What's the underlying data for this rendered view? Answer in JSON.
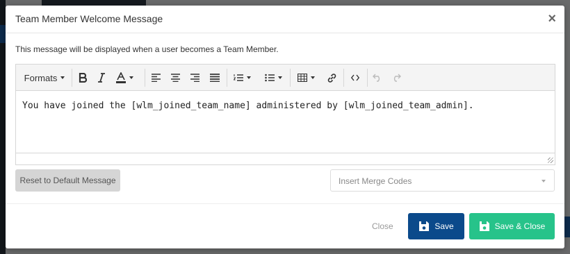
{
  "modal": {
    "title": "Team Member Welcome Message",
    "close_glyph": "×",
    "description": "This message will be displayed when a user becomes a Team Member."
  },
  "editor": {
    "toolbar": {
      "formats_label": "Formats",
      "buttons": [
        "bold-icon",
        "italic-icon",
        "text-color-icon",
        "align-left-icon",
        "align-center-icon",
        "align-right-icon",
        "align-justify-icon",
        "numbered-list-icon",
        "bullet-list-icon",
        "table-icon",
        "link-icon",
        "code-icon",
        "undo-icon",
        "redo-icon"
      ]
    },
    "content": "You have joined the [wlm_joined_team_name] administered by [wlm_joined_team_admin]."
  },
  "reset_button_label": "Reset to Default Message",
  "merge_codes": {
    "placeholder": "Insert Merge Codes"
  },
  "footer": {
    "close_label": "Close",
    "save_label": "Save",
    "save_close_label": "Save & Close"
  },
  "colors": {
    "save": "#0b4a8b",
    "save_close": "#27c38a",
    "reset": "#d5d5d5"
  }
}
